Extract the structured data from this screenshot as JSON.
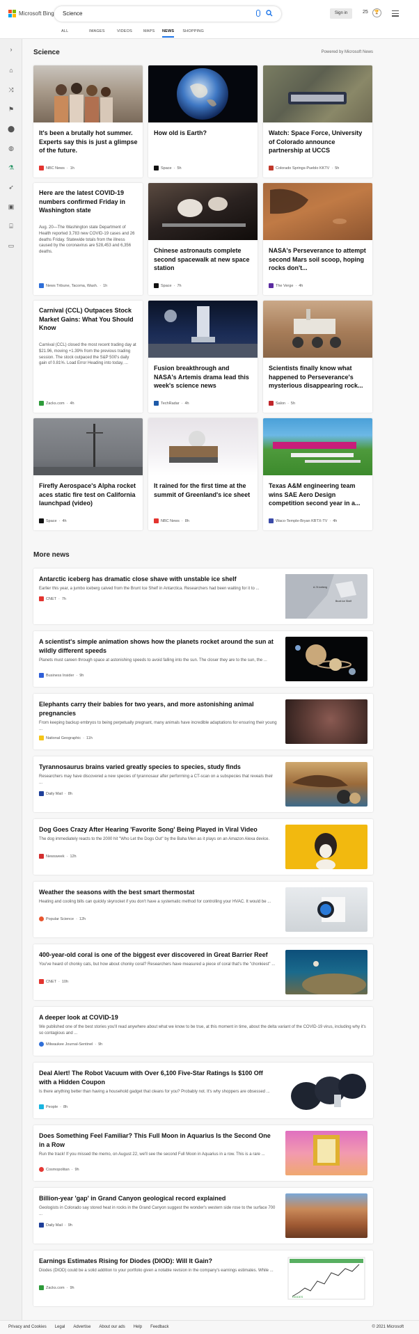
{
  "header": {
    "logo_text": "Microsoft Bing",
    "search_value": "Science",
    "signin_label": "Sign in",
    "points": "25",
    "tabs": [
      "ALL",
      "IMAGES",
      "VIDEOS",
      "MAPS",
      "NEWS",
      "SHOPPING"
    ],
    "active_tab": "NEWS"
  },
  "section": {
    "title": "Science",
    "powered_by": "Powered by Microsoft News"
  },
  "cards": [
    {
      "title": "It's been a brutally hot summer. Experts say this is just a glimpse of the future.",
      "source": "NBC News",
      "time": "1h",
      "icon_color": "#e3342f"
    },
    {
      "title": "How old is Earth?",
      "source": "Space",
      "time": "5h",
      "icon_color": "#111111"
    },
    {
      "title": "Watch: Space Force, University of Colorado announce partnership at UCCS",
      "source": "Colorado Springs-Pueblo KKTV",
      "time": "5h",
      "icon_color": "#c0392b"
    },
    {
      "title": "Here are the latest COVID-19 numbers confirmed Friday in Washington state",
      "snippet": "Aug. 20—The Washington state Department of Health reported 3,783 new COVID-19 cases and 26 deaths Friday. Statewide totals from the illness caused by the coronavirus are 528,453 and 6,356 deaths.",
      "source": "News Tribune, Tacoma, Wash.",
      "time": "1h",
      "icon_color": "#2f6fd8"
    },
    {
      "title": "Chinese astronauts complete second spacewalk at new space station",
      "source": "Space",
      "time": "7h",
      "icon_color": "#111111"
    },
    {
      "title": "NASA's Perseverance to attempt second Mars soil scoop, hoping rocks don't...",
      "source": "The Verge",
      "time": "4h",
      "icon_color": "#5b2ca0"
    },
    {
      "title": "Carnival (CCL) Outpaces Stock Market Gains: What You Should Know",
      "snippet": "Carnival (CCL) closed the most recent trading day at $21.96, moving +1.39% from the previous trading session. The stock outpaced the S&P 500's daily gain of 0.81%. Load Error Heading into today, ...",
      "source": "Zacks.com",
      "time": "4h",
      "icon_color": "#2e9b3a"
    },
    {
      "title": "Fusion breakthrough and NASA's Artemis drama lead this week's science news",
      "source": "TechRadar",
      "time": "4h",
      "icon_color": "#1e5aa8"
    },
    {
      "title": "Scientists finally know what happened to Perseverance's mysterious disappearing rock...",
      "source": "Salon",
      "time": "5h",
      "icon_color": "#c0262b"
    },
    {
      "title": "Firefly Aerospace's Alpha rocket aces static fire test on California launchpad (video)",
      "source": "Space",
      "time": "4h",
      "icon_color": "#111111"
    },
    {
      "title": "It rained for the first time at the summit of Greenland's ice sheet",
      "source": "NBC News",
      "time": "8h",
      "icon_color": "#e3342f"
    },
    {
      "title": "Texas A&M engineering team wins SAE Aero Design competition second year in a...",
      "source": "Waco-Temple-Bryan KBTX-TV",
      "time": "4h",
      "icon_color": "#3b4ba8"
    }
  ],
  "more_news": {
    "title": "More news",
    "items": [
      {
        "title": "Antarctic iceberg has dramatic close shave with unstable ice shelf",
        "snippet": "Earlier this year, a jumbo iceberg calved from the Brunt Ice Shelf in Antarctica. Researchers had been waiting for it to ...",
        "source": "CNET",
        "time": "7h",
        "icon_color": "#e3342f"
      },
      {
        "title": "A scientist's simple animation shows how the planets rocket around the sun at wildly different speeds",
        "snippet": "Planets must careen through space at astonishing speeds to avoid falling into the sun. The closer they are to the sun, the ...",
        "source": "Business Insider",
        "time": "9h",
        "icon_color": "#2f5fd8"
      },
      {
        "title": "Elephants carry their babies for two years, and more astonishing animal pregnancies",
        "snippet": "From keeping backup embryos to being perpetually pregnant, many animals have incredible adaptations for ensuring their young ...",
        "source": "National Geographic",
        "time": "11h",
        "icon_color": "#f5c518"
      },
      {
        "title": "Tyrannosaurus brains varied greatly species to species, study finds",
        "snippet": "Researchers may have discovered a new species of tyrannosaur after performing a CT-scan on a subspecies that reveals their ...",
        "source": "Daily Mail",
        "time": "8h",
        "icon_color": "#1e3f99"
      },
      {
        "title": "Dog Goes Crazy After Hearing 'Favorite Song' Being Played in Viral Video",
        "snippet": "The dog immediately reacts to the 2000 hit \"Who Let the Dogs Out\" by the Baha Men as it plays on an Amazon Alexa device.",
        "source": "Newsweek",
        "time": "12h",
        "icon_color": "#d32f2f"
      },
      {
        "title": "Weather the seasons with the best smart thermostat",
        "snippet": "Heating and cooling bills can quickly skyrocket if you don't have a systematic method for controlling your HVAC. It would be ...",
        "source": "Popular Science",
        "time": "12h",
        "icon_color": "#e8562f"
      },
      {
        "title": "400-year-old coral is one of the biggest ever discovered in Great Barrier Reef",
        "snippet": "You've heard of chonky cats, but how about chonky coral? Researchers have measured a piece of coral that's the \"chonkiest\" ...",
        "source": "CNET",
        "time": "10h",
        "icon_color": "#e3342f"
      },
      {
        "title": "A deeper look at COVID-19",
        "snippet": "We published one of the best stories you'll read anywhere about what we know to be true, at this moment in time, about the delta variant of the COVID-19 virus, including why it's so contagious and ...",
        "source": "Milwaukee Journal-Sentinel",
        "time": "9h",
        "icon_color": "#2f6fd8"
      },
      {
        "title": "Deal Alert! The Robot Vacuum with Over 6,100 Five-Star Ratings Is $100 Off with a Hidden Coupon",
        "snippet": "Is there anything better than having a household gadget that cleans for you? Probably not. It's why shoppers are obsessed ...",
        "source": "People",
        "time": "8h",
        "icon_color": "#18b4e0"
      },
      {
        "title": "Does Something Feel Familiar? This Full Moon in Aquarius Is the Second One in a Row",
        "snippet": "Run the track! If you missed the memo, on August 22, we'll see the second Full Moon in Aquarius in a row. This is a rare ...",
        "source": "Cosmopolitan",
        "time": "9h",
        "icon_color": "#e53935"
      },
      {
        "title": "Billion-year 'gap' in Grand Canyon geological record explained",
        "snippet": "Geologists in Colorado say stored heat in rocks in the Grand Canyon suggest the wonder's western side rose to the surface 700 ...",
        "source": "Daily Mail",
        "time": "9h",
        "icon_color": "#1e3f99"
      },
      {
        "title": "Earnings Estimates Rising for Diodes (DIOD): Will It Gain?",
        "snippet": "Diodes (DIOD) could be a solid addition to your portfolio given a notable revision in the company's earnings estimates. While ...",
        "source": "Zacks.com",
        "time": "9h",
        "icon_color": "#2e9b3a"
      }
    ]
  },
  "thumb_labels": {
    "iceberg": "Brunt Ice Shelf",
    "iceberg_a74": "A-74 iceberg",
    "diod": "DIODES"
  },
  "footer": {
    "links": [
      "Privacy and Cookies",
      "Legal",
      "Advertise",
      "About our ads",
      "Help",
      "Feedback"
    ],
    "copyright": "© 2021 Microsoft"
  }
}
